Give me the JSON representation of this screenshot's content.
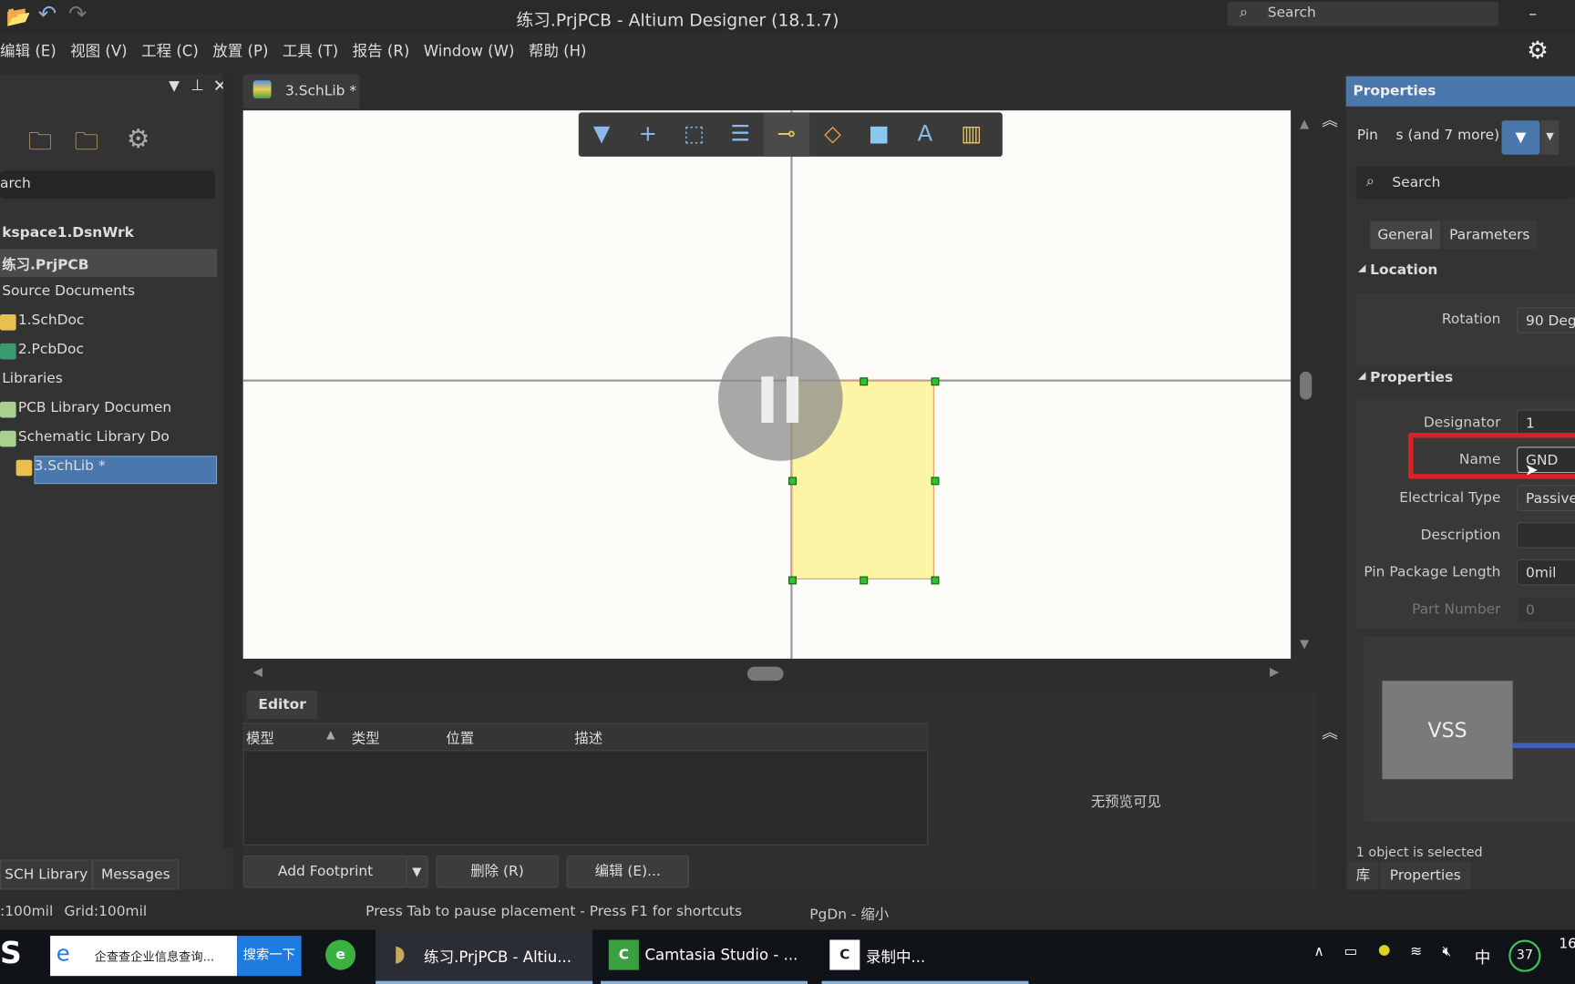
{
  "window": {
    "title": "练习.PrjPCB - Altium Designer (18.1.7)",
    "search_placeholder": "Search"
  },
  "menu": [
    "编辑 (E)",
    "视图 (V)",
    "工程 (C)",
    "放置 (P)",
    "工具 (T)",
    "报告 (R)",
    "Window (W)",
    "帮助 (H)"
  ],
  "projects_panel": {
    "search_placeholder": "arch",
    "tree": [
      "kspace1.DsnWrk",
      "练习.PrjPCB",
      "Source Documents",
      "1.SchDoc",
      "2.PcbDoc",
      "Libraries",
      "PCB Library Documen",
      "Schematic Library Do",
      "3.SchLib *"
    ],
    "bottom_tabs": [
      "SCH Library",
      "Messages"
    ]
  },
  "document_tab": "3.SchLib *",
  "editor": {
    "title": "Editor",
    "columns": [
      "模型",
      "类型",
      "位置",
      "描述"
    ],
    "no_preview": "无预览可见",
    "buttons": {
      "add_footprint": "Add Footprint",
      "delete": "删除 (R)",
      "edit": "编辑 (E)..."
    }
  },
  "properties": {
    "header": "Properties",
    "filter_text": "Pin    s (and 7 more)",
    "search_placeholder": "Search",
    "tabs": [
      "General",
      "Parameters"
    ],
    "location_section": "Location",
    "rotation_label": "Rotation",
    "rotation_value": "90 Deg",
    "properties_section": "Properties",
    "designator_label": "Designator",
    "designator_value": "1",
    "name_label": "Name",
    "name_value": "GND",
    "electrical_type_label": "Electrical Type",
    "electrical_type_value": "Passive",
    "description_label": "Description",
    "description_value": "",
    "pin_package_length_label": "Pin Package Length",
    "pin_package_length_value": "0mil",
    "part_number_label": "Part Number",
    "part_number_value": "0",
    "preview_label": "VSS",
    "selection_status": "1 object is selected",
    "bottom_tabs": [
      "库",
      "Properties"
    ]
  },
  "status_bar": {
    "snap": ":100mil",
    "grid": "Grid:100mil",
    "hint": "Press Tab to pause placement - Press F1 for shortcuts",
    "pgdn": "PgDn - 缩小"
  },
  "taskbar": {
    "search_text": "企查查企业信息查询...",
    "search_button": "搜索一下",
    "apps": [
      "练习.PrjPCB - Altiu...",
      "Camtasia Studio - ...",
      "录制中..."
    ],
    "ime": "中",
    "badge": "37",
    "clock": "16"
  },
  "colors": {
    "accent": "#4a7ab0",
    "highlight_box": "#e02020",
    "component_fill": "#fdf5a6"
  }
}
